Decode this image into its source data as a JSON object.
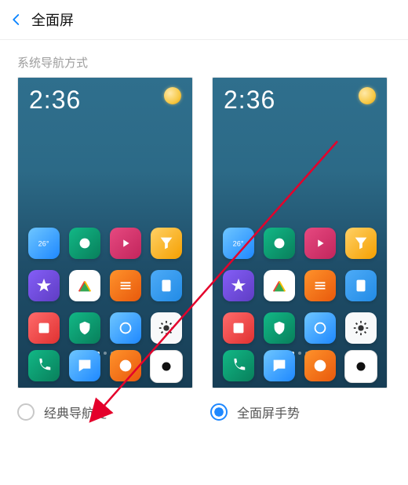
{
  "header": {
    "title": "全面屏"
  },
  "section_label": "系统导航方式",
  "clock": "2:36",
  "options": {
    "classic": {
      "label": "经典导航键",
      "selected": false
    },
    "gesture": {
      "label": "全面屏手势",
      "selected": true
    }
  }
}
